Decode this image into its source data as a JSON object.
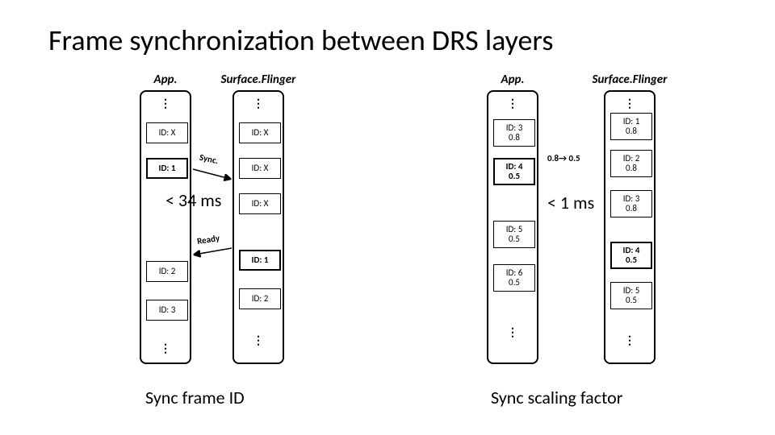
{
  "title": "Frame synchronization between DRS layers",
  "labels": {
    "app": "App.",
    "sf": "Surface.Flinger",
    "sync": "Sync.",
    "ready": "Ready",
    "transition": "0.8→ 0.5",
    "mid_left": "< 34 ms",
    "mid_right": "< 1 ms",
    "cap_left": "Sync frame ID",
    "cap_right": "Sync scaling factor"
  },
  "left": {
    "app_cells": [
      {
        "l1": "ID: X",
        "bold": false
      },
      {
        "l1": "ID: 1",
        "bold": true
      },
      {
        "l1": "ID: 2",
        "bold": false
      },
      {
        "l1": "ID: 3",
        "bold": false
      }
    ],
    "sf_cells": [
      {
        "l1": "ID: X",
        "bold": false
      },
      {
        "l1": "ID: X",
        "bold": false
      },
      {
        "l1": "ID: X",
        "bold": false
      },
      {
        "l1": "ID: 1",
        "bold": true
      },
      {
        "l1": "ID: 2",
        "bold": false
      }
    ]
  },
  "right": {
    "app_cells": [
      {
        "l1": "ID: 3",
        "l2": "0.8",
        "bold": false
      },
      {
        "l1": "ID: 4",
        "l2": "0.5",
        "bold": true
      },
      {
        "l1": "ID: 5",
        "l2": "0.5",
        "bold": false
      },
      {
        "l1": "ID: 6",
        "l2": "0.5",
        "bold": false
      }
    ],
    "sf_cells": [
      {
        "l1": "ID: 1",
        "l2": "0.8",
        "bold": false
      },
      {
        "l1": "ID: 2",
        "l2": "0.8",
        "bold": false
      },
      {
        "l1": "ID: 3",
        "l2": "0.8",
        "bold": false
      },
      {
        "l1": "ID: 4",
        "l2": "0.5",
        "bold": true
      },
      {
        "l1": "ID: 5",
        "l2": "0.5",
        "bold": false
      }
    ]
  }
}
